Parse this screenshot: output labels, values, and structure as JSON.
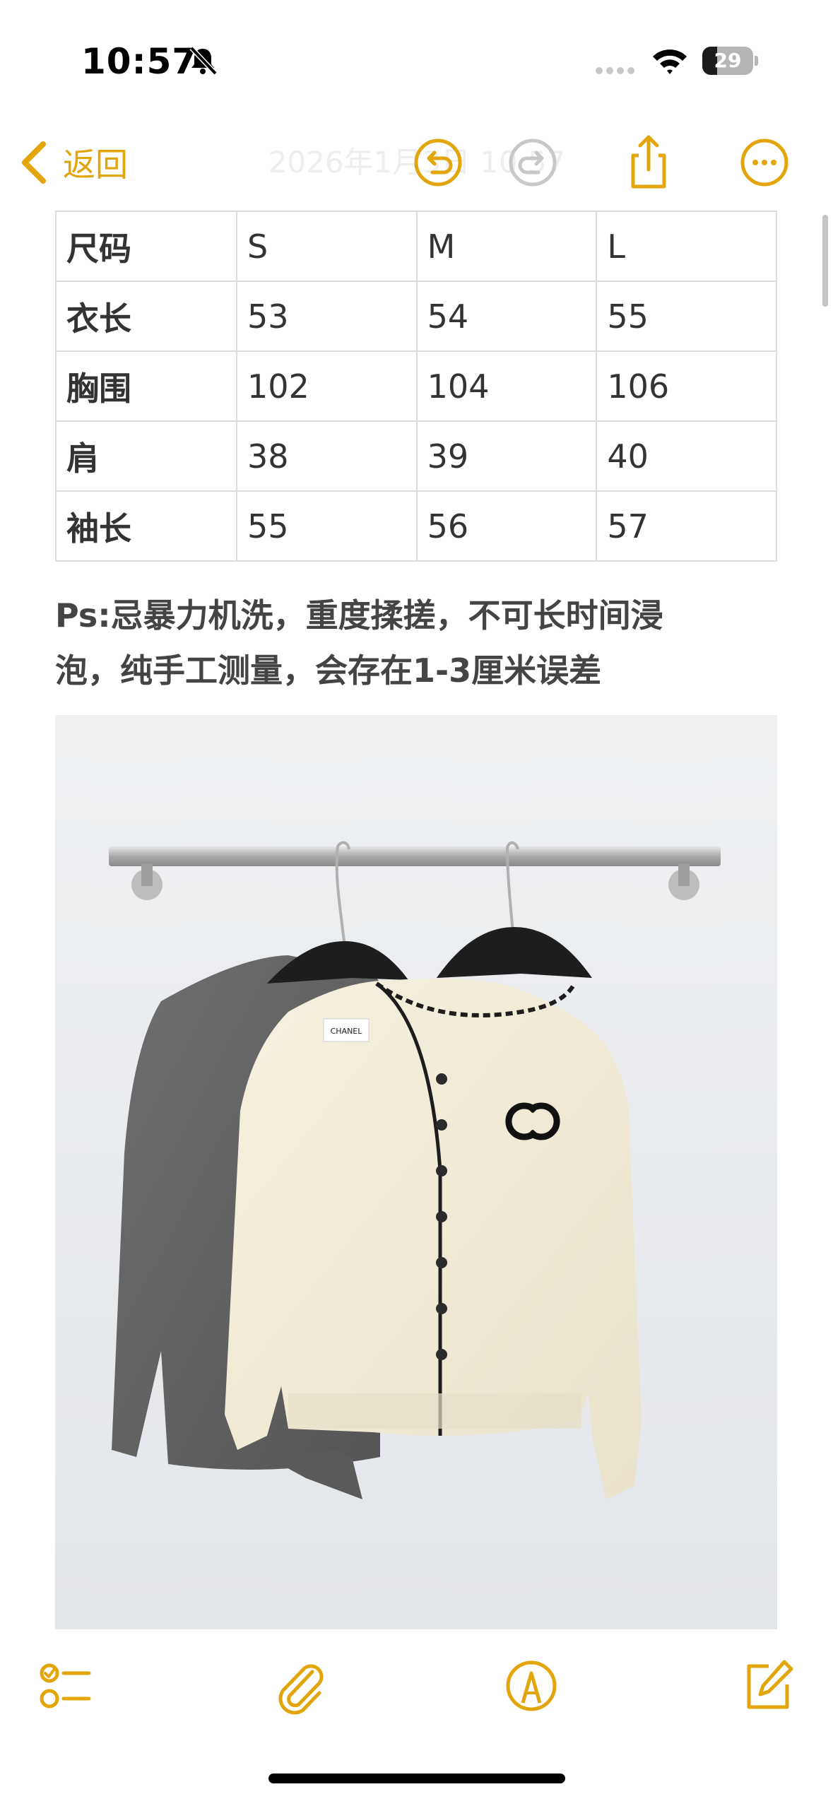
{
  "status_bar": {
    "time": "10:57",
    "battery_level": "29",
    "battery_fraction": 0.29,
    "icons": [
      "bell-slash-icon",
      "cellular-signal-icon",
      "wifi-icon",
      "battery-icon"
    ]
  },
  "nav": {
    "back_label": "返回",
    "title": "2026年1月3日 10:57",
    "accent_color": "#e2a60c",
    "icons": [
      "chevron-left-icon",
      "undo-icon",
      "redo-icon",
      "share-icon",
      "more-icon"
    ]
  },
  "size_table": {
    "rows": [
      [
        "尺码",
        "S",
        "M",
        "L"
      ],
      [
        "衣长",
        "53",
        "54",
        "55"
      ],
      [
        "胸围",
        "102",
        "104",
        "106"
      ],
      [
        "肩",
        "38",
        "39",
        "40"
      ],
      [
        "袖长",
        "55",
        "56",
        "57"
      ]
    ]
  },
  "note": {
    "line1": "Ps:忌暴力机洗，重度揉搓，不可长时间浸",
    "line2": "泡，纯手工测量，会存在1-3厘米误差"
  },
  "photo": {
    "label_text": "CHANEL"
  },
  "toolbar": {
    "icons": [
      "checklist-icon",
      "paperclip-icon",
      "markup-pen-icon",
      "compose-icon"
    ]
  }
}
